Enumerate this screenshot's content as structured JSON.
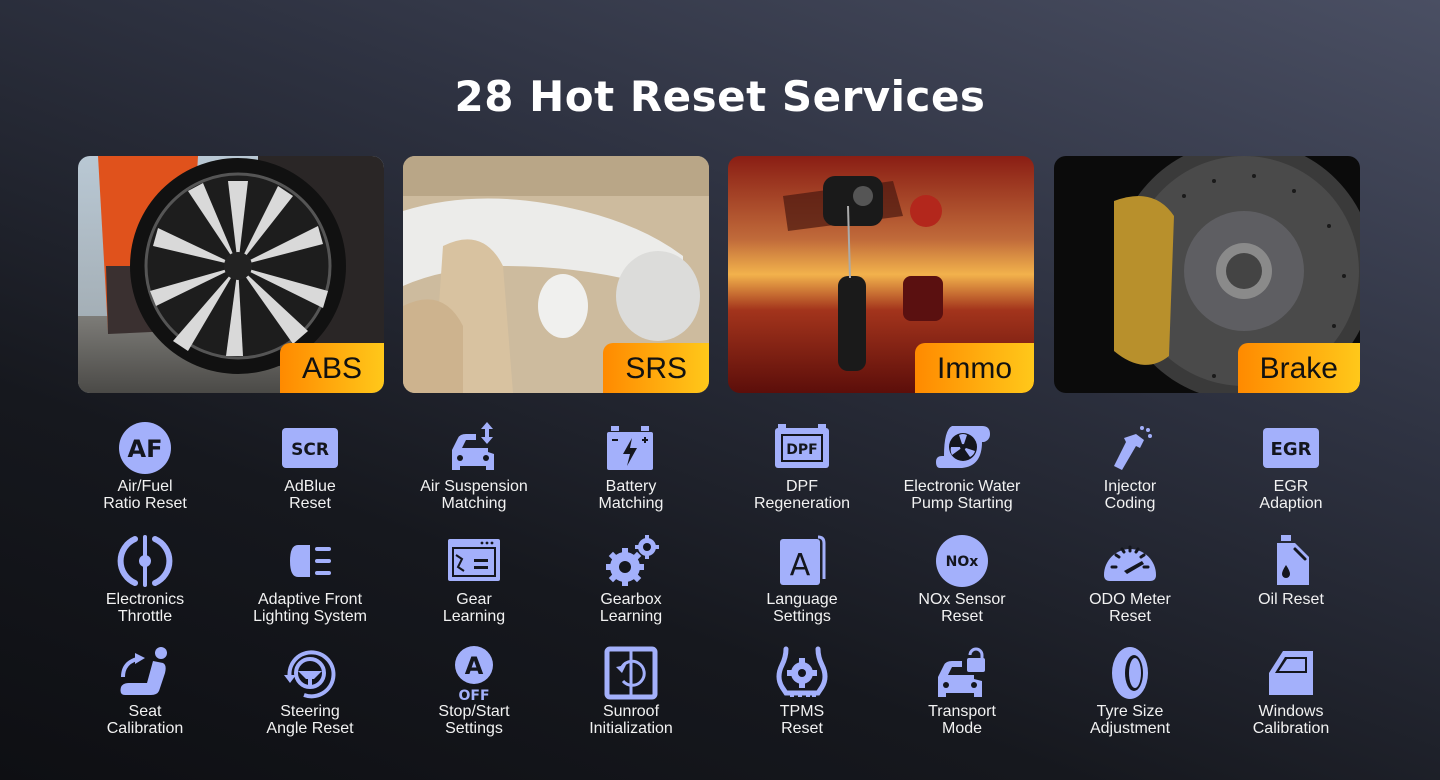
{
  "title": "28 Hot Reset Services",
  "accent_color": "#a3b0fb",
  "badge_gradient": [
    "#ff8a00",
    "#ffc81a"
  ],
  "cards": [
    {
      "label": "ABS",
      "image": "car-wheel-photo"
    },
    {
      "label": "SRS",
      "image": "airbag-interior-photo"
    },
    {
      "label": "Immo",
      "image": "car-key-photo"
    },
    {
      "label": "Brake",
      "image": "brake-disc-photo"
    }
  ],
  "services": [
    {
      "line1": "Air/Fuel",
      "line2": "Ratio Reset",
      "icon": "af-icon"
    },
    {
      "line1": "AdBlue",
      "line2": "Reset",
      "icon": "scr-icon"
    },
    {
      "line1": "Air Suspension",
      "line2": "Matching",
      "icon": "air-suspension-icon"
    },
    {
      "line1": "Battery",
      "line2": "Matching",
      "icon": "battery-icon"
    },
    {
      "line1": "DPF",
      "line2": "Regeneration",
      "icon": "dpf-icon"
    },
    {
      "line1": "Electronic Water",
      "line2": "Pump Starting",
      "icon": "water-pump-icon"
    },
    {
      "line1": "Injector",
      "line2": "Coding",
      "icon": "injector-icon"
    },
    {
      "line1": "EGR",
      "line2": "Adaption",
      "icon": "egr-icon"
    },
    {
      "line1": "Electronics",
      "line2": "Throttle",
      "icon": "throttle-icon"
    },
    {
      "line1": "Adaptive Front",
      "line2": "Lighting System",
      "icon": "headlight-icon"
    },
    {
      "line1": "Gear",
      "line2": "Learning",
      "icon": "gear-learning-icon"
    },
    {
      "line1": "Gearbox",
      "line2": "Learning",
      "icon": "gearbox-icon"
    },
    {
      "line1": "Language",
      "line2": "Settings",
      "icon": "language-icon"
    },
    {
      "line1": "NOx Sensor",
      "line2": "Reset",
      "icon": "nox-icon"
    },
    {
      "line1": "ODO Meter",
      "line2": "Reset",
      "icon": "odometer-icon"
    },
    {
      "line1": "Oil Reset",
      "line2": "",
      "icon": "oil-can-icon"
    },
    {
      "line1": "Seat",
      "line2": "Calibration",
      "icon": "seat-icon"
    },
    {
      "line1": "Steering",
      "line2": "Angle Reset",
      "icon": "steering-icon"
    },
    {
      "line1": "Stop/Start",
      "line2": "Settings",
      "icon": "auto-stop-off-icon"
    },
    {
      "line1": "Sunroof",
      "line2": "Initialization",
      "icon": "sunroof-icon"
    },
    {
      "line1": "TPMS",
      "line2": "Reset",
      "icon": "tpms-icon"
    },
    {
      "line1": "Transport",
      "line2": "Mode",
      "icon": "transport-lock-icon"
    },
    {
      "line1": "Tyre Size",
      "line2": "Adjustment",
      "icon": "tyre-icon"
    },
    {
      "line1": "Windows",
      "line2": "Calibration",
      "icon": "window-door-icon"
    }
  ],
  "icon_text": {
    "af": "AF",
    "scr": "SCR",
    "dpf": "DPF",
    "egr": "EGR",
    "lang": "A",
    "nox": "NOx",
    "stop_a": "A",
    "stop_off": "OFF"
  }
}
